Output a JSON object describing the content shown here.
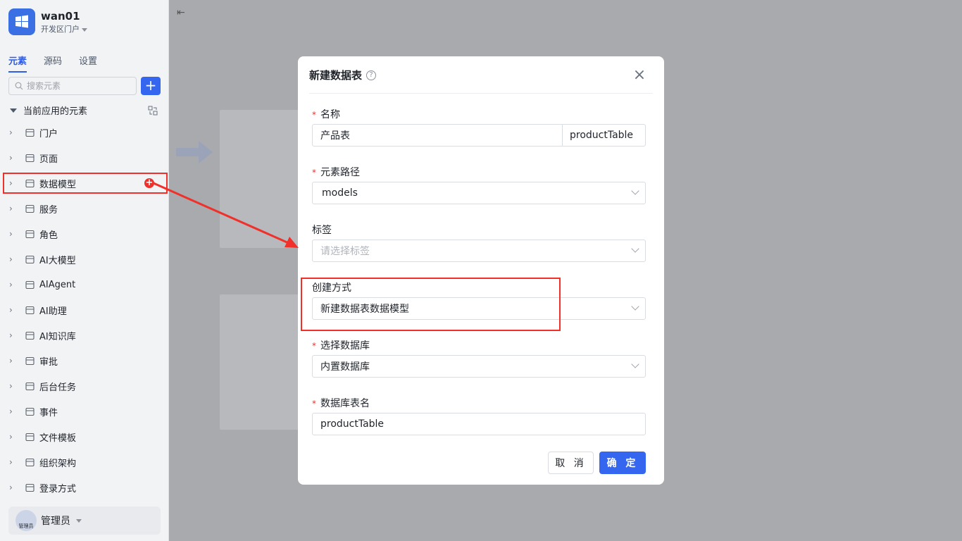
{
  "app": {
    "name": "wan01",
    "subtitle": "开发区门户"
  },
  "tabs": [
    "元素",
    "源码",
    "设置"
  ],
  "search": {
    "placeholder": "搜索元素",
    "add_label": "+"
  },
  "tree": {
    "header": "当前应用的元素",
    "items": [
      {
        "label": "门户",
        "icon": "home-icon"
      },
      {
        "label": "页面",
        "icon": "page-icon"
      },
      {
        "label": "数据模型",
        "icon": "table-icon"
      },
      {
        "label": "服务",
        "icon": "service-icon"
      },
      {
        "label": "角色",
        "icon": "role-icon"
      },
      {
        "label": "AI大模型",
        "icon": "ai-model-icon"
      },
      {
        "label": "AIAgent",
        "icon": "robot-icon"
      },
      {
        "label": "AI助理",
        "icon": "ai-assistant-icon"
      },
      {
        "label": "AI知识库",
        "icon": "knowledge-icon"
      },
      {
        "label": "审批",
        "icon": "approval-icon"
      },
      {
        "label": "后台任务",
        "icon": "task-icon"
      },
      {
        "label": "事件",
        "icon": "event-icon"
      },
      {
        "label": "文件模板",
        "icon": "file-template-icon"
      },
      {
        "label": "组织架构",
        "icon": "org-icon"
      },
      {
        "label": "登录方式",
        "icon": "login-icon"
      }
    ]
  },
  "user": {
    "name": "管理员",
    "avatar_text": "管理员"
  },
  "modal": {
    "title": "新建数据表",
    "close": "×",
    "fields": {
      "name": {
        "label": "名称",
        "value": "产品表",
        "code": "productTable"
      },
      "path": {
        "label": "元素路径",
        "value": "models"
      },
      "tags": {
        "label": "标签",
        "placeholder": "请选择标签"
      },
      "create_mode": {
        "label": "创建方式",
        "value": "新建数据表数据模型"
      },
      "database": {
        "label": "选择数据库",
        "value": "内置数据库"
      },
      "table_name": {
        "label": "数据库表名",
        "value": "productTable"
      }
    },
    "cancel_label": "取 消",
    "ok_label": "确 定"
  },
  "colors": {
    "primary": "#3566f0",
    "annotation": "#f0302a"
  }
}
